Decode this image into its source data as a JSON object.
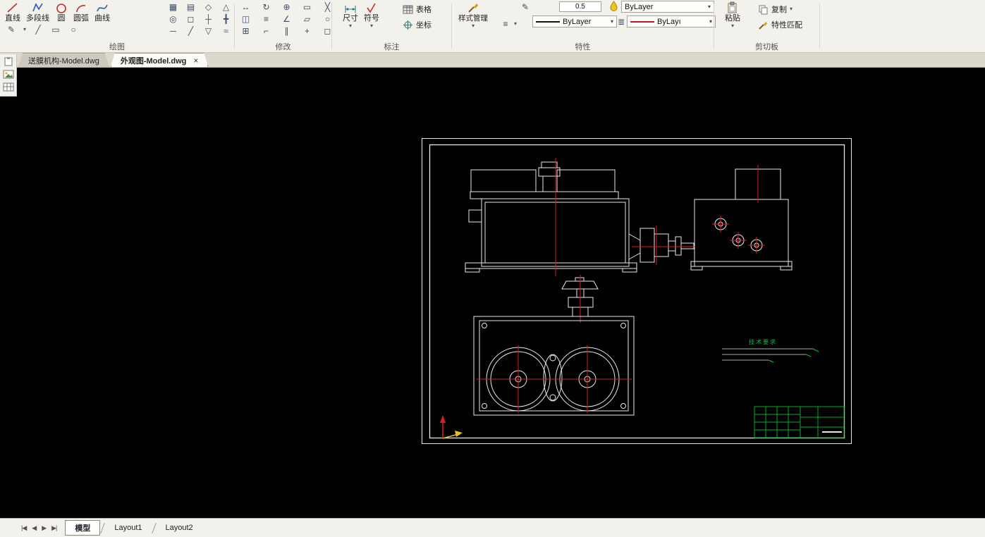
{
  "ribbon": {
    "draw": {
      "label": "绘图",
      "buttons": [
        {
          "label": "直线"
        },
        {
          "label": "多段线"
        },
        {
          "label": "圆"
        },
        {
          "label": "圆弧"
        },
        {
          "label": "曲线"
        }
      ]
    },
    "modify": {
      "label": "修改"
    },
    "annotate": {
      "label": "标注",
      "dimension": "尺寸",
      "symbol": "符号",
      "table": "表格",
      "coordinate": "坐标"
    },
    "properties": {
      "label": "特性",
      "style_manager": "样式管理",
      "lineweight": "0.5",
      "color_value": "ByLayer",
      "linetype_value": "ByLayer",
      "linecolor_value": "ByLayı"
    },
    "clipboard": {
      "label": "剪切板",
      "paste": "粘贴",
      "copy": "复制",
      "match": "特性匹配"
    }
  },
  "doc_tabs": [
    {
      "label": "送膜机构-Model.dwg"
    },
    {
      "label": "外观图-Model.dwg"
    }
  ],
  "drawing": {
    "tech_requirements": "技术要求"
  },
  "statusbar": {
    "model_tab": "模型",
    "layout1_tab": "Layout1",
    "layout2_tab": "Layout2"
  },
  "glyphs": {
    "dropdown": "▾",
    "close": "×",
    "nav_first": "|◀",
    "nav_prev": "◀",
    "nav_next": "▶",
    "nav_last": "▶|",
    "hamburger": "≡",
    "lineweight_icon": "≣"
  },
  "icon_glyphs": {
    "draw_small": [
      "✎",
      "╱",
      "▭",
      "○"
    ],
    "draw_grid": [
      "▦",
      "▤",
      "◇",
      "△",
      "◎",
      "◻",
      "┼",
      "╋",
      "─",
      "╱",
      "▽",
      "≈"
    ],
    "modify_grid": [
      "↔",
      "↻",
      "⊕",
      "▭",
      "╳",
      "◫",
      "≡",
      "∠",
      "▱",
      "○",
      "⊞",
      "⌐",
      "∥",
      "+",
      "◻"
    ]
  },
  "colors": {
    "canvas_bg": "#000000",
    "geometry_white": "#e8e8e8",
    "centerline_red": "#d42020",
    "annotation_green": "#00c040",
    "titleblock_green": "#00a82e"
  }
}
